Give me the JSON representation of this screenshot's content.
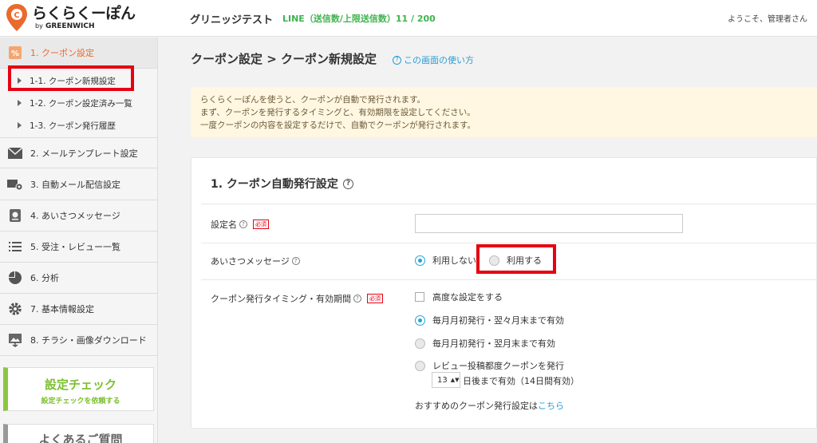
{
  "header": {
    "logo_main": "らくらくーぽん",
    "logo_by": "by",
    "logo_brand": "GREENWICH",
    "shop_name": "グリニッジテスト",
    "line_count": "LINE（送信数/上限送信数）11 / 200",
    "welcome": "ようこそ、管理者さん"
  },
  "sidebar": {
    "items": [
      {
        "label": "1. クーポン設定",
        "icon": "coupon-percent-icon"
      },
      {
        "label": "2. メールテンプレート設定",
        "icon": "envelope-icon"
      },
      {
        "label": "3. 自動メール配信設定",
        "icon": "mail-gear-icon"
      },
      {
        "label": "4. あいさつメッセージ",
        "icon": "greeting-card-icon"
      },
      {
        "label": "5. 受注・レビュー一覧",
        "icon": "list-icon"
      },
      {
        "label": "6. 分析",
        "icon": "pie-chart-icon"
      },
      {
        "label": "7. 基本情報設定",
        "icon": "gear-icon"
      },
      {
        "label": "8. チラシ・画像ダウンロード",
        "icon": "image-download-icon"
      }
    ],
    "subitems": [
      {
        "label": "1-1. クーポン新規設定"
      },
      {
        "label": "1-2. クーポン設定済み一覧"
      },
      {
        "label": "1-3. クーポン発行履歴"
      }
    ],
    "check_title": "設定チェック",
    "check_sub": "設定チェックを依頼する",
    "faq_title": "よくあるご質問"
  },
  "main": {
    "page_title": "クーポン設定 > クーポン新規設定",
    "help_link": "この画面の使い方",
    "notice": [
      "らくらくーぽんを使うと、クーポンが自動で発行されます。",
      "まず、クーポンを発行するタイミングと、有効期限を設定してください。",
      "一度クーポンの内容を設定するだけで、自動でクーポンが発行されます。"
    ],
    "panel_title": "1. クーポン自動発行設定",
    "fields": {
      "name_label": "設定名",
      "required": "必須",
      "greeting_label": "あいさつメッセージ",
      "greeting_off": "利用しない",
      "greeting_on": "利用する",
      "timing_label": "クーポン発行タイミング・有効期間",
      "advanced": "高度な設定をする",
      "opt1": "毎月月初発行・翌々月末まで有効",
      "opt2": "毎月月初発行・翌月末まで有効",
      "opt3": "レビュー投稿都度クーポンを発行",
      "days_value": "13",
      "days_suffix": "日後まで有効（14日間有効）",
      "rec_text": "おすすめのクーポン発行設定は",
      "rec_link": "こちら"
    }
  },
  "colors": {
    "accent_orange": "#e96a2d",
    "line_green": "#3fb34f",
    "link_blue": "#2a9cd6",
    "highlight_red": "#e60012",
    "check_green": "#7bbf2e"
  }
}
